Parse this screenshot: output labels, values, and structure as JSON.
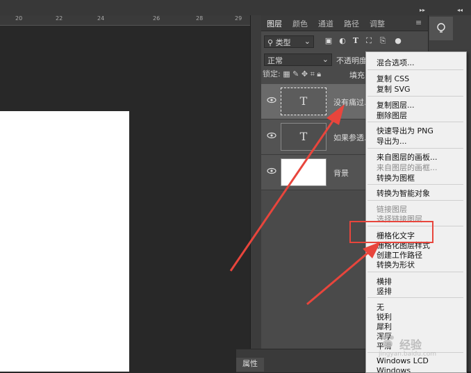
{
  "ruler": {
    "ticks": [
      "20",
      "22",
      "24",
      "26",
      "28",
      "29"
    ]
  },
  "panel": {
    "tabs": [
      "图层",
      "颜色",
      "通道",
      "路径",
      "调整"
    ],
    "filter_label": "类型",
    "blend_mode": "正常",
    "opacity_label": "不透明度",
    "lock_label": "锁定:",
    "fill_label": "填充"
  },
  "layers": [
    {
      "name": "没有痛过..",
      "thumb": "T"
    },
    {
      "name": "如果参透..",
      "thumb": "T"
    },
    {
      "name": "背景",
      "thumb": ""
    }
  ],
  "properties_tab": "属性",
  "context_menu": {
    "items": [
      {
        "label": "混合选项...",
        "disabled": false
      },
      {
        "label": "复制 CSS",
        "disabled": false
      },
      {
        "label": "复制 SVG",
        "disabled": false
      },
      {
        "label": "复制图层...",
        "disabled": false
      },
      {
        "label": "删除图层",
        "disabled": false
      },
      {
        "label": "快速导出为 PNG",
        "disabled": false
      },
      {
        "label": "导出为...",
        "disabled": false
      },
      {
        "label": "来自图层的画板...",
        "disabled": false
      },
      {
        "label": "来自图层的画框...",
        "disabled": true
      },
      {
        "label": "转换为图框",
        "disabled": false
      },
      {
        "label": "转换为智能对象",
        "disabled": false
      },
      {
        "label": "链接图层",
        "disabled": true
      },
      {
        "label": "选择链接图层",
        "disabled": true
      },
      {
        "label": "栅格化文字",
        "disabled": false
      },
      {
        "label": "栅格化图层样式",
        "disabled": false
      },
      {
        "label": "创建工作路径",
        "disabled": false
      },
      {
        "label": "转换为形状",
        "disabled": false
      },
      {
        "label": "横排",
        "disabled": false
      },
      {
        "label": "竖排",
        "disabled": false
      },
      {
        "label": "无",
        "disabled": false
      },
      {
        "label": "锐利",
        "disabled": false
      },
      {
        "label": "犀利",
        "disabled": false
      },
      {
        "label": "浑厚",
        "disabled": false
      },
      {
        "label": "平滑",
        "disabled": false
      },
      {
        "label": "Windows LCD",
        "disabled": false
      },
      {
        "label": "Windows",
        "disabled": false
      }
    ]
  },
  "watermark": {
    "text": "经验",
    "url": "jingyan.baidu.com"
  },
  "colors": {
    "highlight": "#e8453c",
    "panel_bg": "#4a4a4a",
    "menu_bg": "#f0f0f0"
  },
  "icons": [
    "eye-icon",
    "lightbulb-icon",
    "text-filter-icon",
    "menu-icon"
  ]
}
